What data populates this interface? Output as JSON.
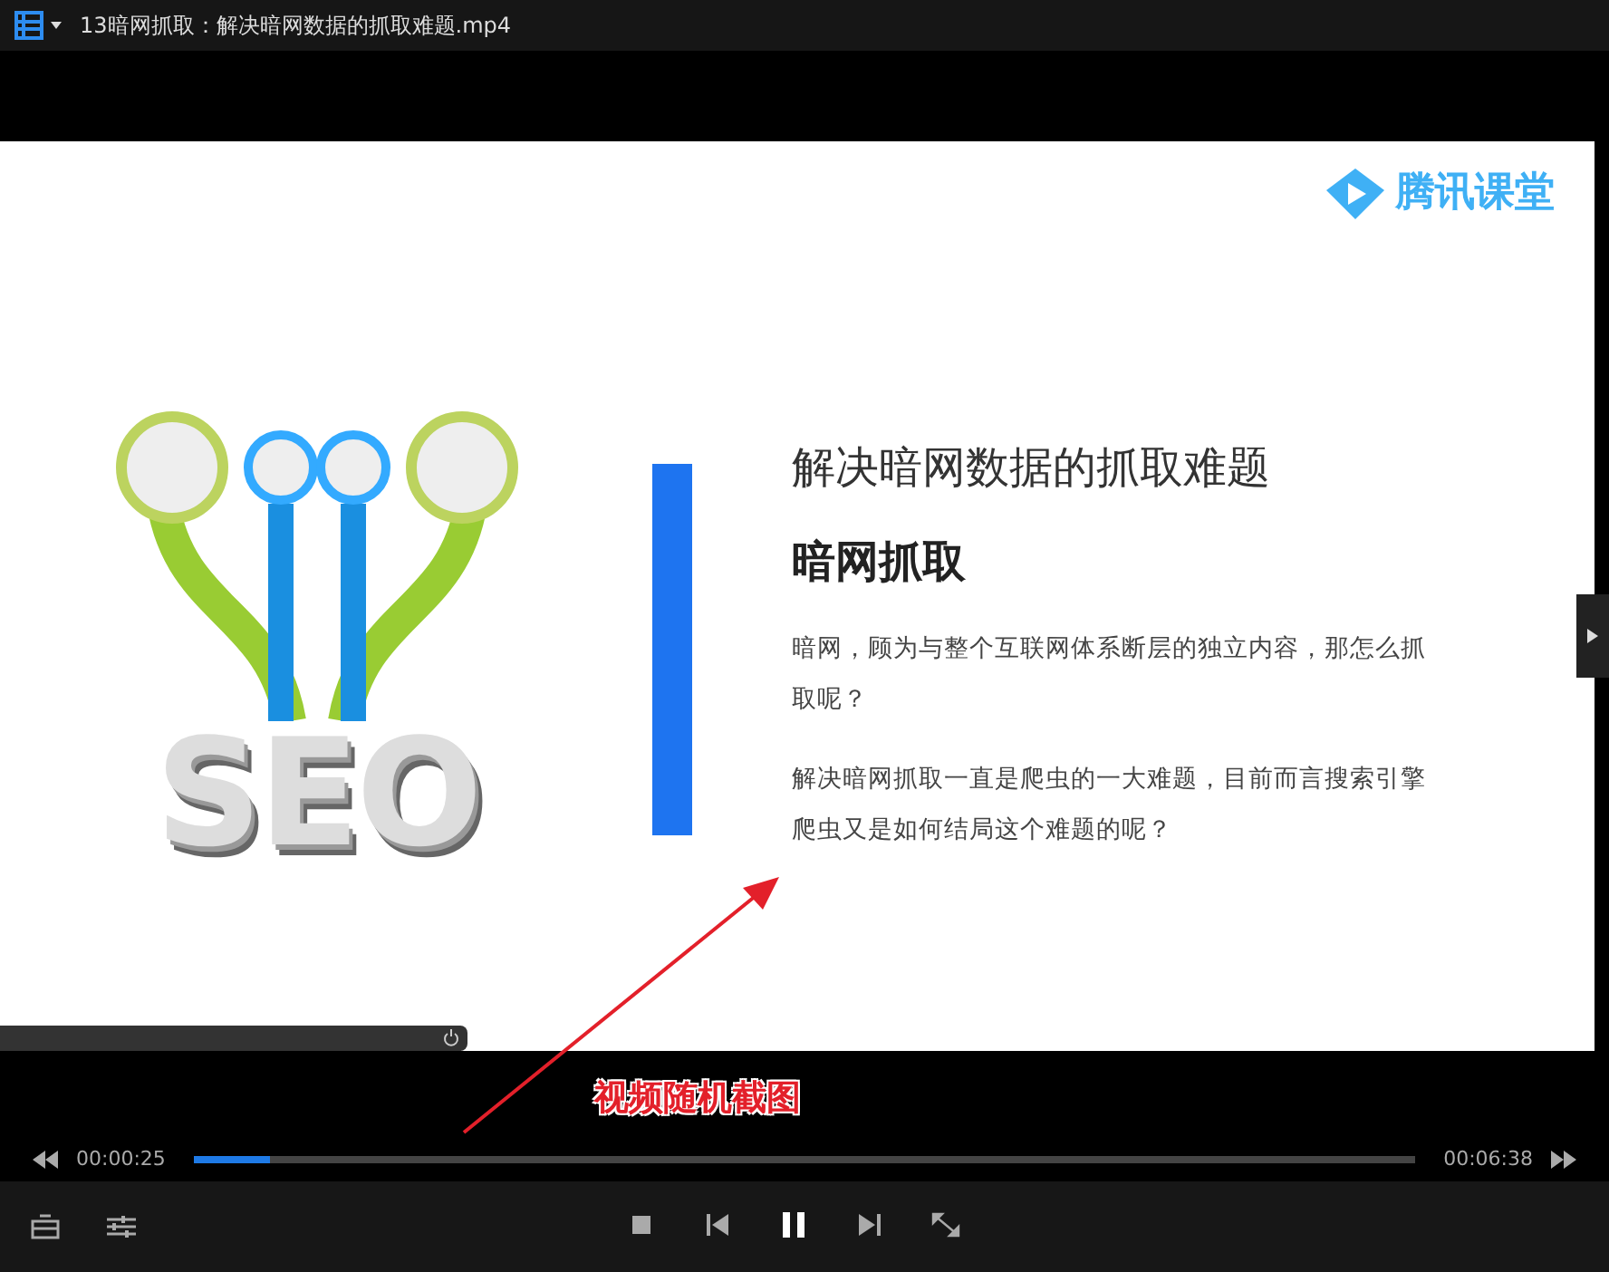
{
  "window": {
    "title": "13暗网抓取：解决暗网数据的抓取难题.mp4"
  },
  "slide": {
    "logo": "腾讯课堂",
    "art_text": "SEO",
    "heading": "解决暗网数据的抓取难题",
    "subheading": "暗网抓取",
    "paragraphs": [
      "暗网，顾为与整个互联网体系断层的独立内容，那怎么抓取呢？",
      "解决暗网抓取一直是爬虫的一大难题，目前而言搜索引擎爬虫又是如何结局这个难题的呢？"
    ]
  },
  "annotation": {
    "label": "视频随机截图"
  },
  "playback": {
    "elapsed": "00:00:25",
    "duration": "00:06:38",
    "level": 0.062,
    "playing": true
  }
}
